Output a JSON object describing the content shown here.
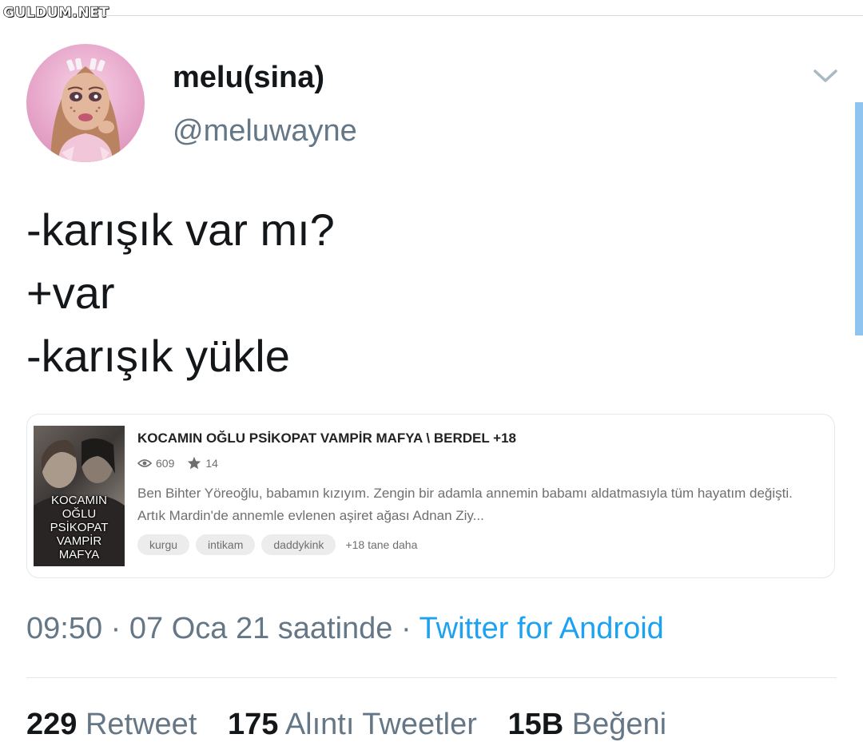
{
  "watermark": "GULDUM.NET",
  "user": {
    "display_name": "melu(sina)",
    "handle": "@meluwayne"
  },
  "tweet": {
    "lines": [
      "-karışık var mı?",
      "+var",
      "-karışık yükle"
    ]
  },
  "card": {
    "cover_text": [
      "KOCAMIN OĞLU",
      "PSİKOPAT VAMPİR",
      "MAFYA"
    ],
    "title": "KOCAMIN OĞLU PSİKOPAT VAMPİR MAFYA \\ BERDEL +18",
    "views": "609",
    "votes": "14",
    "description": "Ben Bihter Yöreoğlu, babamın kızıyım. Zengin bir adamla annemin babamı aldatmasıyla tüm hayatım değişti. Artık Mardin'de annemle evlenen aşiret ağası Adnan Ziy...",
    "tags": [
      "kurgu",
      "intikam",
      "daddykink"
    ],
    "more_tags": "+18 tane daha"
  },
  "meta": {
    "time": "09:50",
    "separator": " · ",
    "date": "07 Oca 21 saatinde",
    "source": "Twitter for Android"
  },
  "counts": {
    "retweets": "229",
    "retweets_label": "Retweet",
    "quotes": "175",
    "quotes_label": "Alıntı Tweetler",
    "likes": "15B",
    "likes_label": "Beğeni"
  },
  "colors": {
    "link": "#1da1f2",
    "secondary_text": "#657786",
    "primary_text": "#14171a",
    "scroll_accent": "#8fc3f0"
  }
}
